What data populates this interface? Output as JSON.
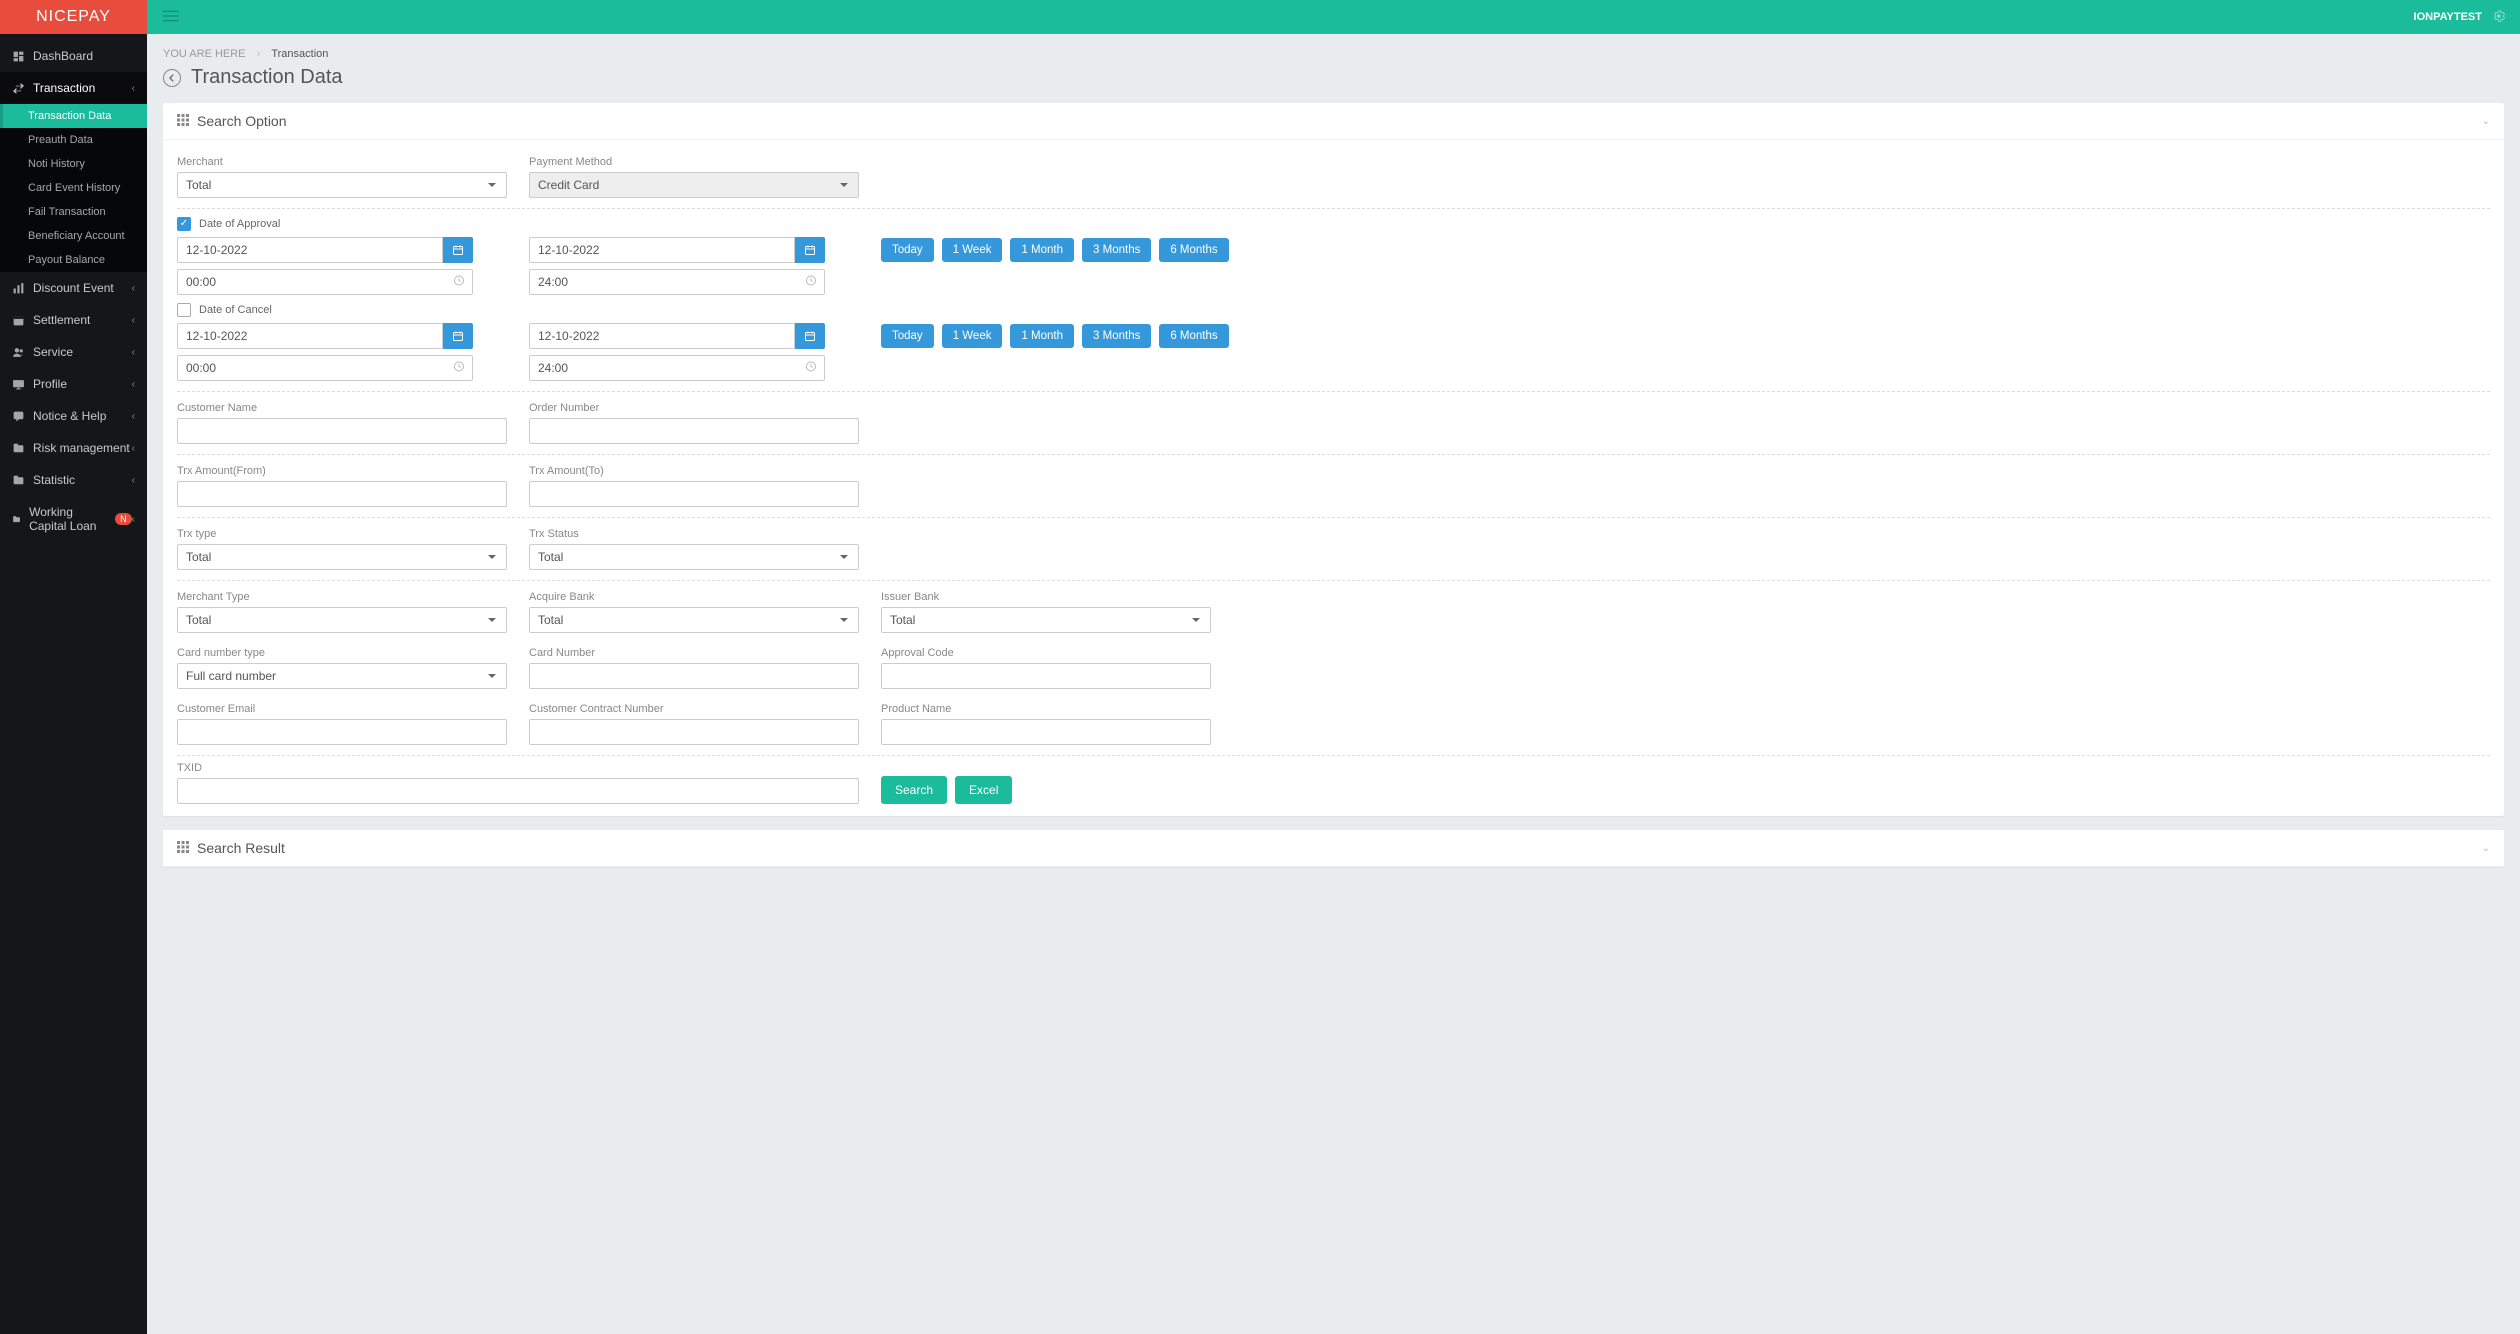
{
  "brand": "NICEPAY",
  "user": "IONPAYTEST",
  "breadcrumb": {
    "label": "YOU ARE HERE",
    "current": "Transaction"
  },
  "page_title": "Transaction Data",
  "sidebar": {
    "items": [
      {
        "label": "DashBoard",
        "icon": "dashboard"
      },
      {
        "label": "Transaction",
        "icon": "transfer",
        "open": true,
        "children": [
          {
            "label": "Transaction Data",
            "active": true
          },
          {
            "label": "Preauth Data"
          },
          {
            "label": "Noti History"
          },
          {
            "label": "Card Event History"
          },
          {
            "label": "Fail Transaction"
          },
          {
            "label": "Beneficiary Account"
          },
          {
            "label": "Payout Balance"
          }
        ]
      },
      {
        "label": "Discount Event",
        "icon": "chart"
      },
      {
        "label": "Settlement",
        "icon": "calendar"
      },
      {
        "label": "Service",
        "icon": "users"
      },
      {
        "label": "Profile",
        "icon": "desktop"
      },
      {
        "label": "Notice & Help",
        "icon": "comment"
      },
      {
        "label": "Risk management",
        "icon": "folder"
      },
      {
        "label": "Statistic",
        "icon": "folder"
      },
      {
        "label": "Working Capital Loan",
        "icon": "folder",
        "badge": "N"
      }
    ]
  },
  "panels": {
    "search_option": "Search Option",
    "search_result": "Search Result"
  },
  "labels": {
    "merchant": "Merchant",
    "payment_method": "Payment Method",
    "date_of_approval": "Date of Approval",
    "date_of_cancel": "Date of Cancel",
    "customer_name": "Customer Name",
    "order_number": "Order Number",
    "trx_amount_from": "Trx Amount(From)",
    "trx_amount_to": "Trx Amount(To)",
    "trx_type": "Trx type",
    "trx_status": "Trx Status",
    "merchant_type": "Merchant Type",
    "acquire_bank": "Acquire Bank",
    "issuer_bank": "Issuer Bank",
    "card_number_type": "Card number type",
    "card_number": "Card Number",
    "approval_code": "Approval Code",
    "customer_email": "Customer Email",
    "customer_contract_number": "Customer Contract Number",
    "product_name": "Product Name",
    "txid": "TXID"
  },
  "values": {
    "merchant": "Total",
    "payment_method": "Credit Card",
    "approval_from_date": "12-10-2022",
    "approval_to_date": "12-10-2022",
    "approval_from_time": "00:00",
    "approval_to_time": "24:00",
    "cancel_from_date": "12-10-2022",
    "cancel_to_date": "12-10-2022",
    "cancel_from_time": "00:00",
    "cancel_to_time": "24:00",
    "trx_type": "Total",
    "trx_status": "Total",
    "merchant_type": "Total",
    "acquire_bank": "Total",
    "issuer_bank": "Total",
    "card_number_type": "Full card number"
  },
  "presets": [
    "Today",
    "1 Week",
    "1 Month",
    "3 Months",
    "6 Months"
  ],
  "buttons": {
    "search": "Search",
    "excel": "Excel"
  }
}
